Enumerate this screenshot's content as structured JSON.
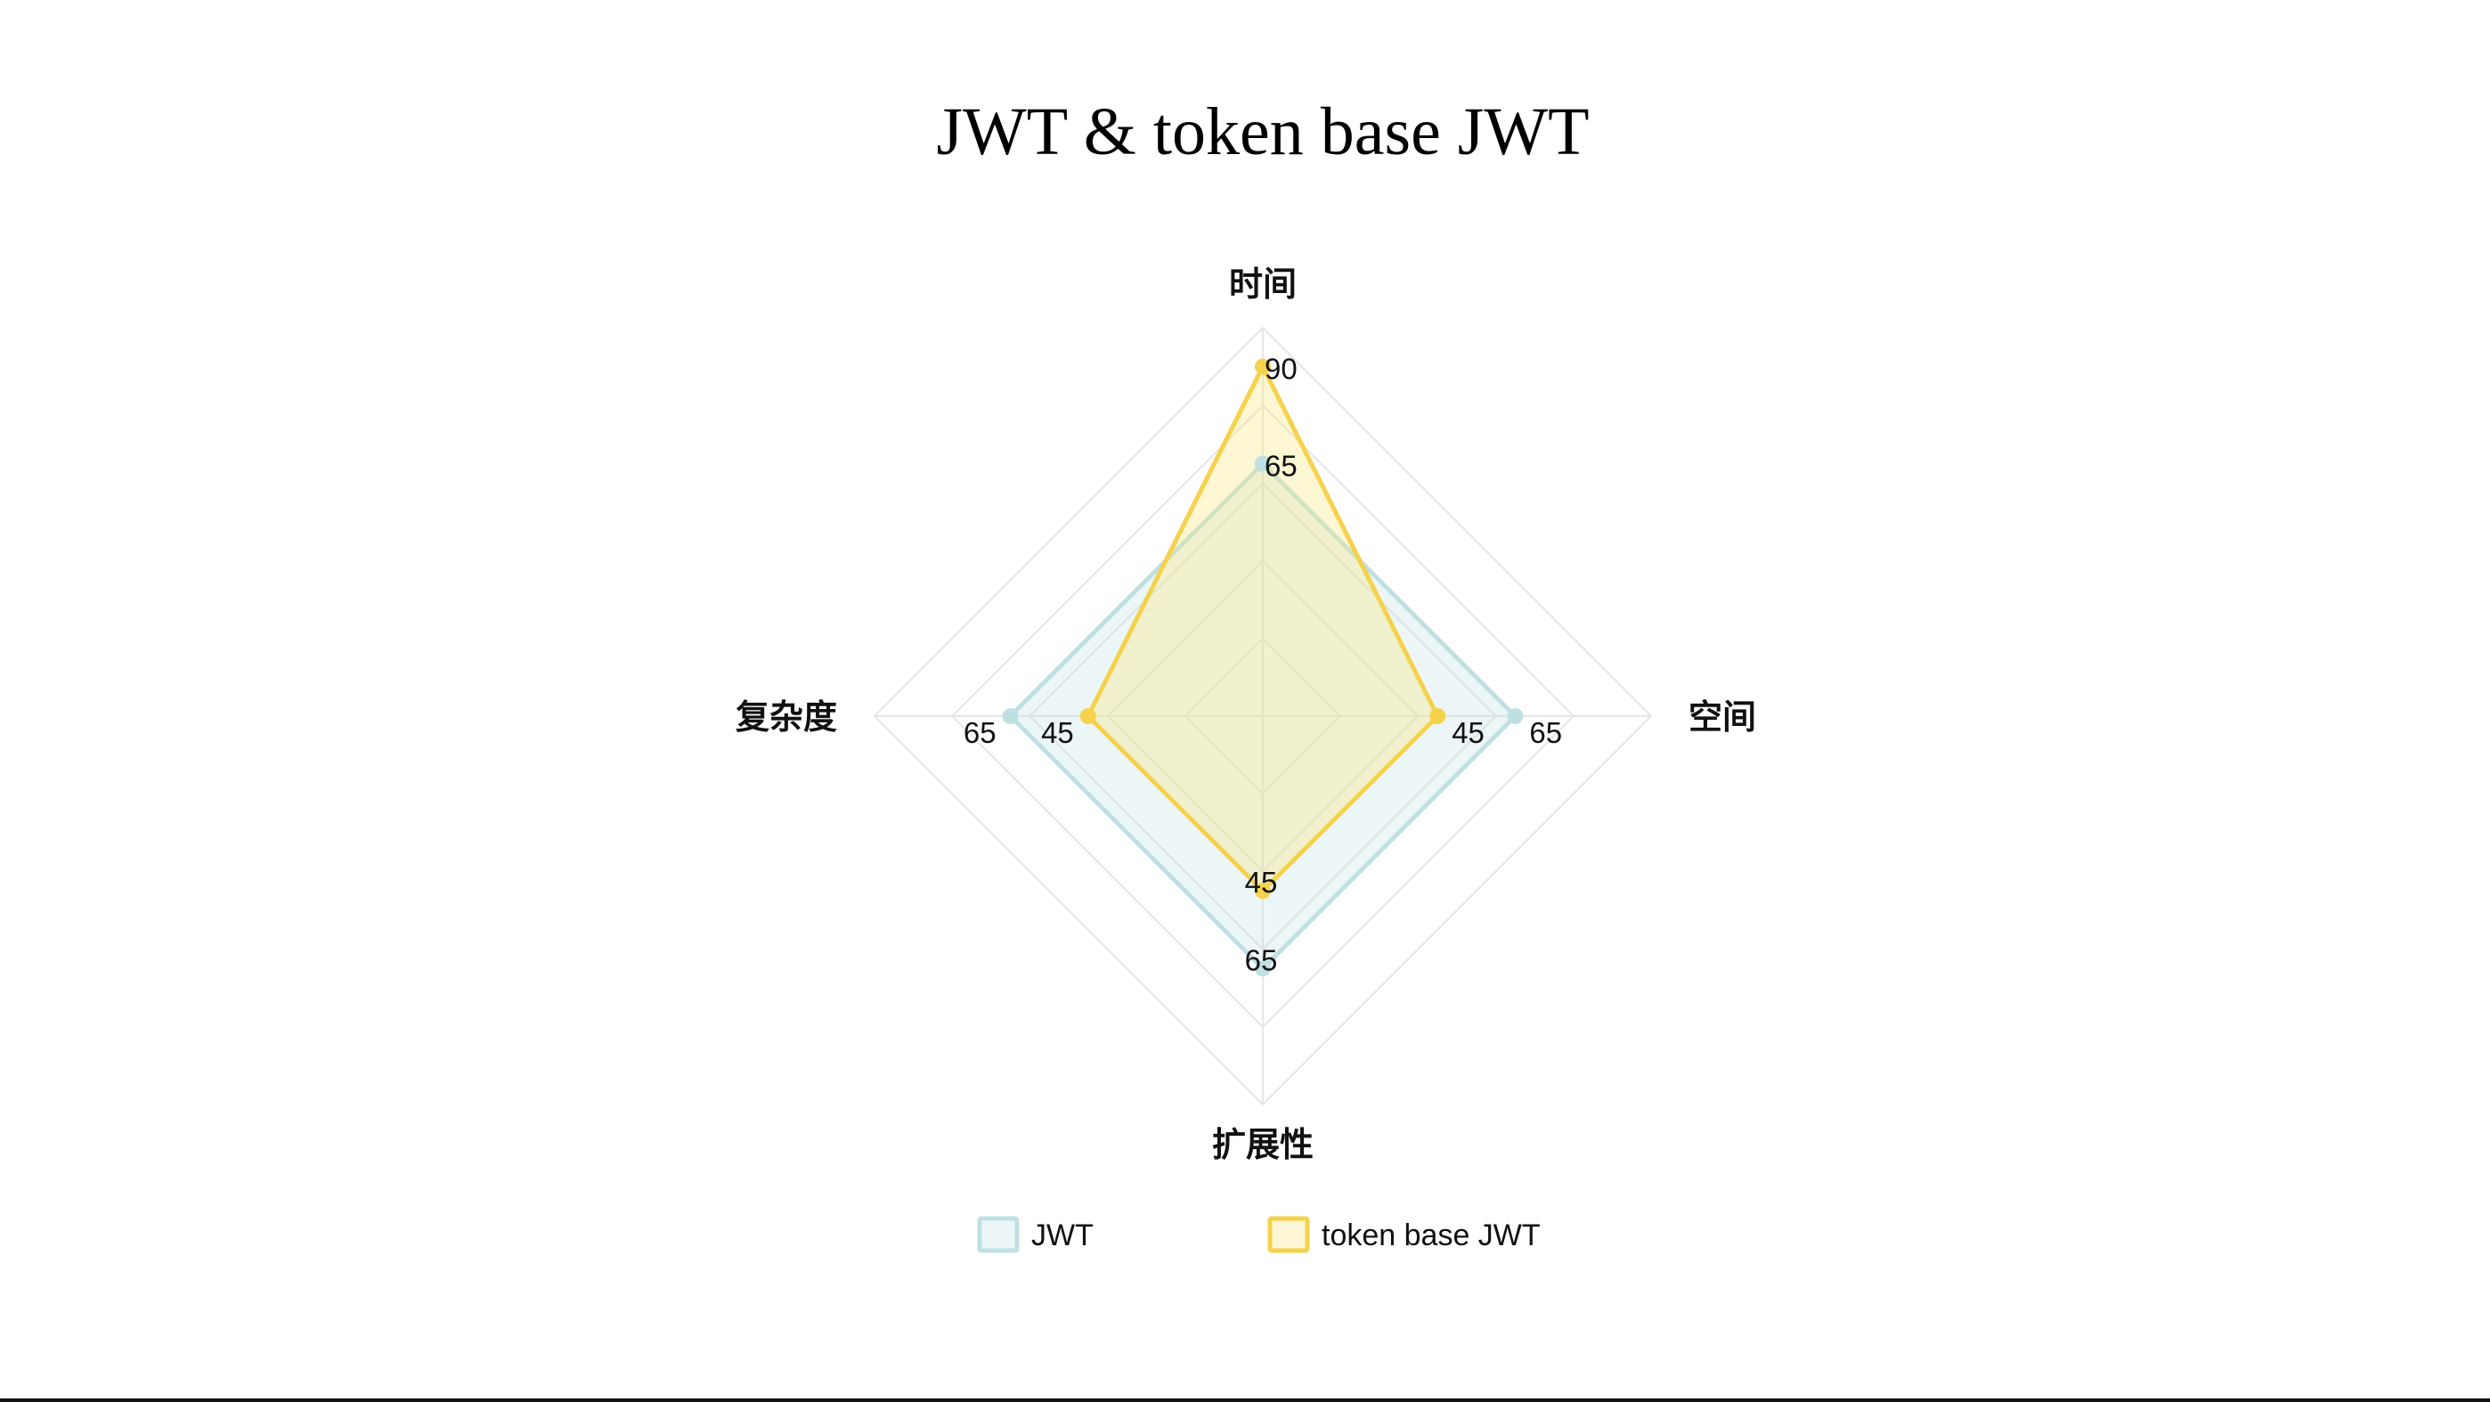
{
  "title": "JWT & token base JWT",
  "chart_data": {
    "type": "radar",
    "axes": [
      "时间",
      "空间",
      "扩展性",
      "复杂度"
    ],
    "range": [
      0,
      100
    ],
    "grid": true,
    "legend_position": "bottom",
    "series": [
      {
        "name": "JWT",
        "values": [
          65,
          65,
          65,
          65
        ],
        "labels": [
          "65",
          "65",
          "65",
          "65"
        ],
        "stroke": "#bfe0e3",
        "fill": "#bfe0e3"
      },
      {
        "name": "token base JWT",
        "values": [
          90,
          45,
          45,
          45
        ],
        "labels": [
          "90",
          "45",
          "45",
          "45"
        ],
        "stroke": "#f5d24b",
        "fill": "#f8e67a"
      }
    ]
  }
}
